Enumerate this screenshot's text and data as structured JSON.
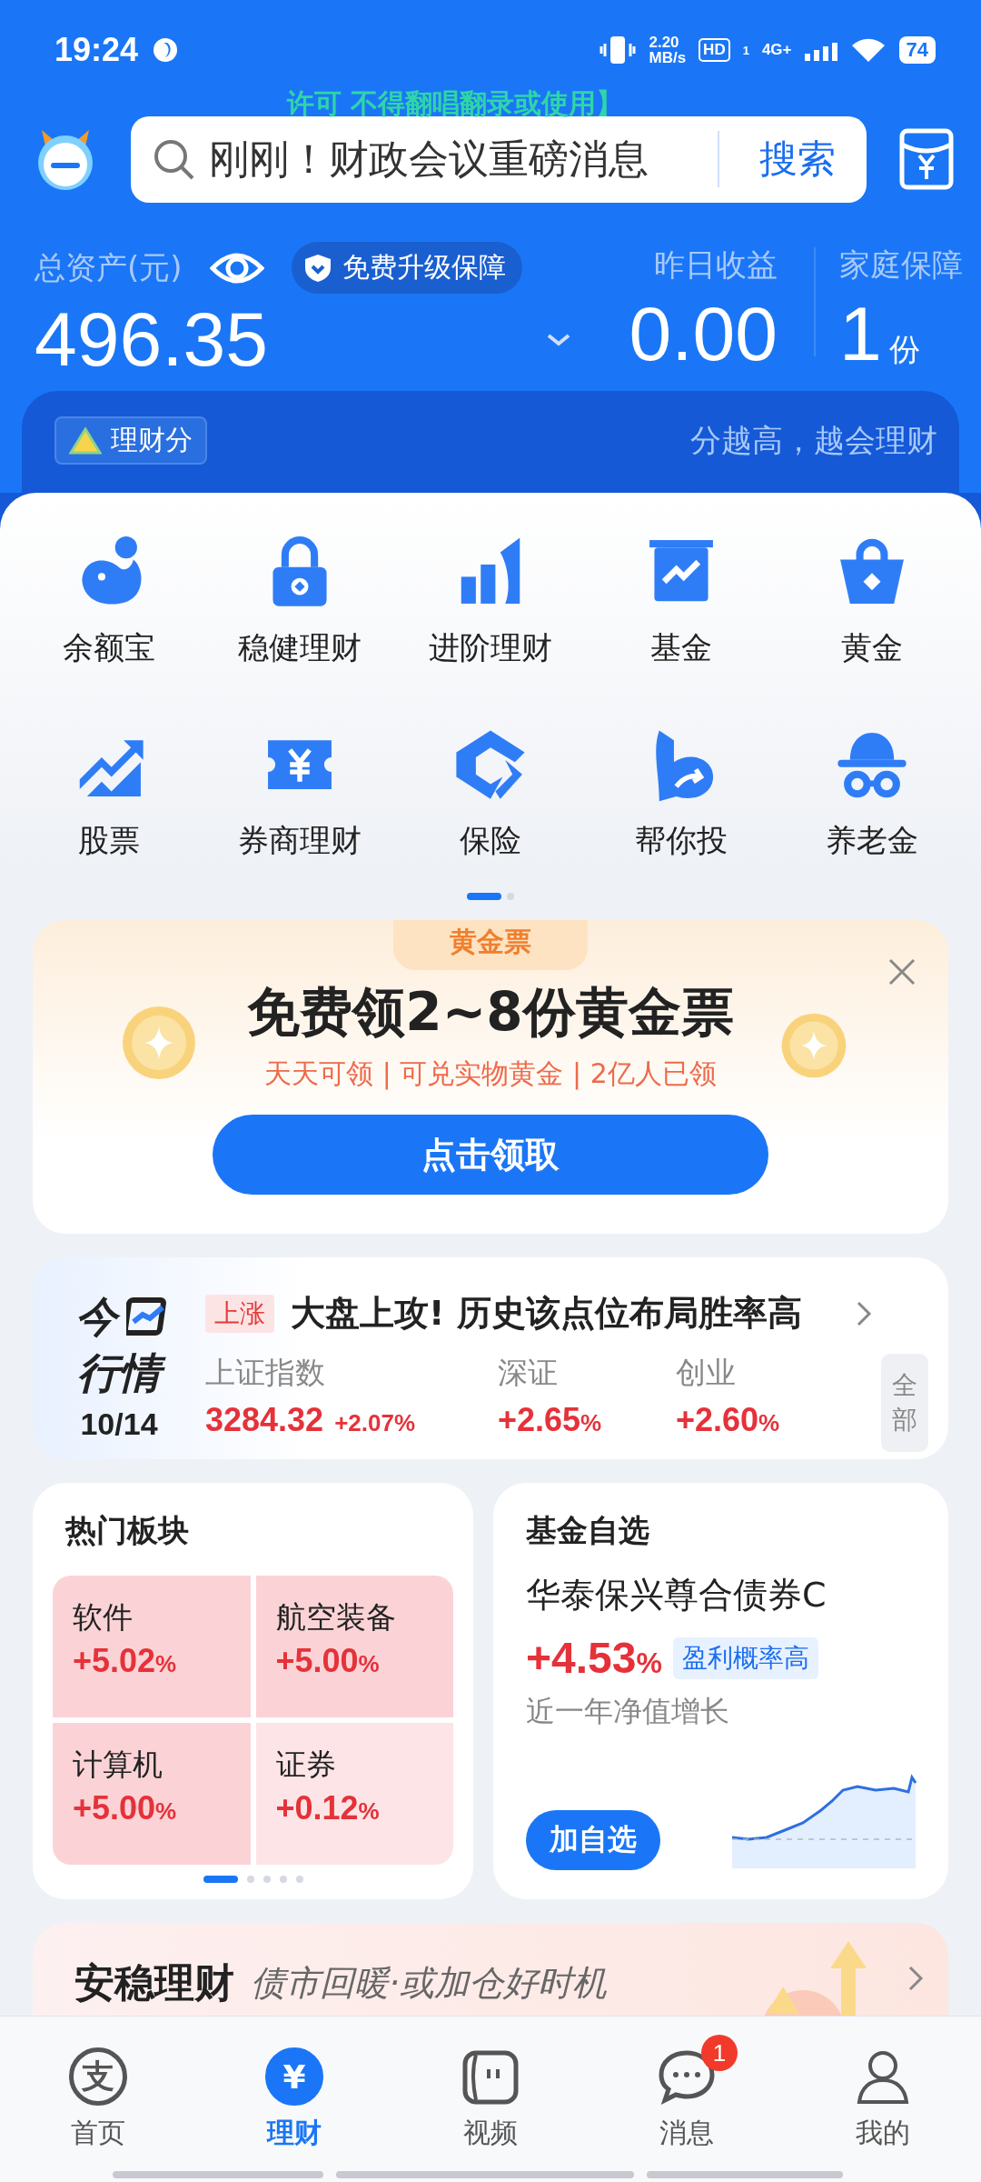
{
  "status_bar": {
    "time": "19:24",
    "net_speed": "2.20",
    "net_unit": "MB/s",
    "hd": "HD",
    "sim": "1",
    "network": "4G+",
    "battery": "74"
  },
  "floating_lyrics": "许可 不得翻唱翻录或使用】",
  "search": {
    "value": "刚刚！财政会议重磅消息",
    "button": "搜索"
  },
  "assets": {
    "label": "总资产(元)",
    "value": "496.35",
    "badge": "免费升级保障",
    "yesterday_label": "昨日收益",
    "yesterday_value": "0.00",
    "family_label": "家庭保障",
    "family_value": "1",
    "family_unit": "份"
  },
  "score": {
    "label": "理财分",
    "hint": "分越高，越会理财"
  },
  "shortcuts": [
    {
      "label": "余额宝"
    },
    {
      "label": "稳健理财"
    },
    {
      "label": "进阶理财"
    },
    {
      "label": "基金"
    },
    {
      "label": "黄金"
    },
    {
      "label": "股票"
    },
    {
      "label": "券商理财"
    },
    {
      "label": "保险"
    },
    {
      "label": "帮你投"
    },
    {
      "label": "养老金"
    }
  ],
  "shortcut_pages": [
    {
      "selected": true
    },
    {
      "selected": false
    }
  ],
  "gold_promo": {
    "tag": "黄金票",
    "title": "免费领2~8份黄金票",
    "subtitle": "天天可领 | 可兑实物黄金 | 2亿人已领",
    "button": "点击领取"
  },
  "market": {
    "logo_top": "今",
    "logo_bottom": "行情",
    "date": "10/14",
    "tag": "上涨",
    "headline": "大盘上攻! 历史该点位布局胜率高",
    "all": "全部",
    "indices": [
      {
        "name": "上证指数",
        "value": "3284.32",
        "change": "+2.07%"
      },
      {
        "name": "深证",
        "change": "+2.65",
        "unit": "%"
      },
      {
        "name": "创业",
        "change": "+2.60",
        "unit": "%"
      }
    ]
  },
  "hot_sectors": {
    "title": "热门板块",
    "items": [
      {
        "name": "软件",
        "change": "+5.02",
        "unit": "%",
        "color": "#fbd3d6"
      },
      {
        "name": "航空装备",
        "change": "+5.00",
        "unit": "%",
        "color": "#fbd3d6"
      },
      {
        "name": "计算机",
        "change": "+5.00",
        "unit": "%",
        "color": "#fbd3d6"
      },
      {
        "name": "证券",
        "change": "+0.12",
        "unit": "%",
        "color": "#fde4e6"
      }
    ],
    "pages": [
      {
        "selected": true
      },
      {
        "selected": false
      },
      {
        "selected": false
      },
      {
        "selected": false
      },
      {
        "selected": false
      }
    ]
  },
  "fund_pick": {
    "title": "基金自选",
    "name": "华泰保兴尊合债券C",
    "return": "+4.53",
    "unit": "%",
    "tag": "盈利概率高",
    "caption": "近一年净值增长",
    "button": "加自选"
  },
  "steady": {
    "title": "安稳理财",
    "subtitle": "债市回暖·或加仓好时机"
  },
  "tabs": [
    {
      "label": "首页",
      "glyph": "支",
      "selected": false
    },
    {
      "label": "理财",
      "glyph": "¥",
      "selected": true
    },
    {
      "label": "视频",
      "selected": false
    },
    {
      "label": "消息",
      "badge": "1",
      "selected": false
    },
    {
      "label": "我的",
      "selected": false
    }
  ]
}
